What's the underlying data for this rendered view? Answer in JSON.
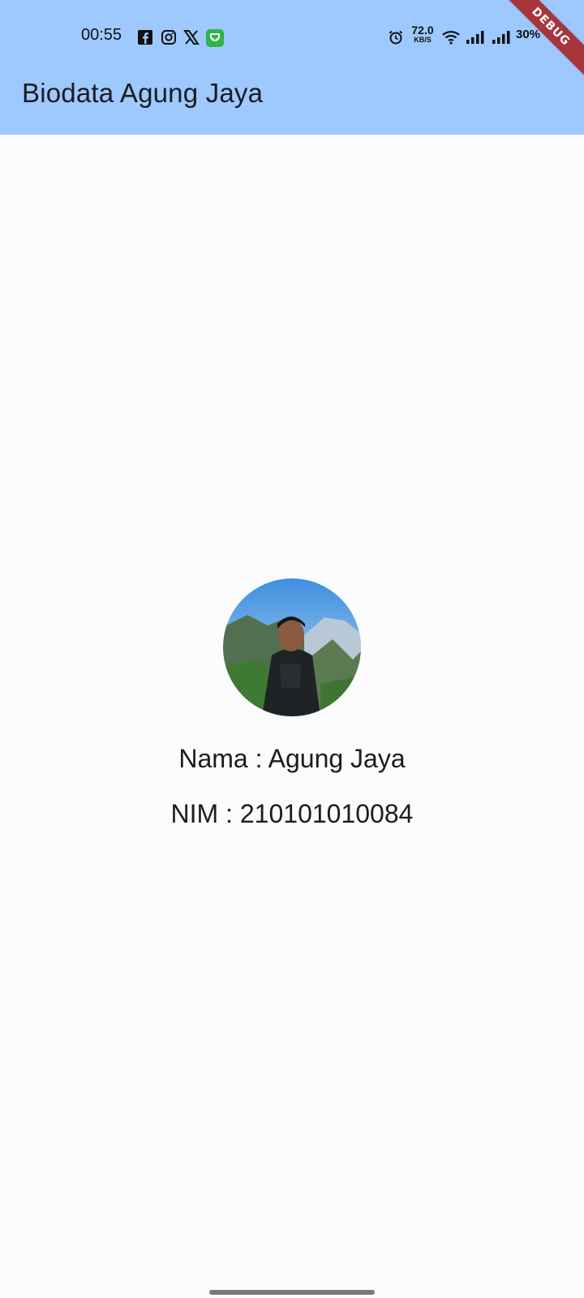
{
  "status_bar": {
    "time": "00:55",
    "net_speed_value": "72.0",
    "net_speed_unit": "KB/S",
    "battery": "30%",
    "icons": [
      "facebook-icon",
      "instagram-icon",
      "x-icon",
      "app-icon",
      "alarm-icon",
      "wifi-icon",
      "signal-icon",
      "signal-icon"
    ]
  },
  "app_bar": {
    "title": "Biodata Agung Jaya",
    "background": "#9ec9fe"
  },
  "debug_banner": "DEBUG",
  "profile": {
    "name_line": "Nama : Agung Jaya",
    "nim_line": "NIM : 210101010084"
  }
}
